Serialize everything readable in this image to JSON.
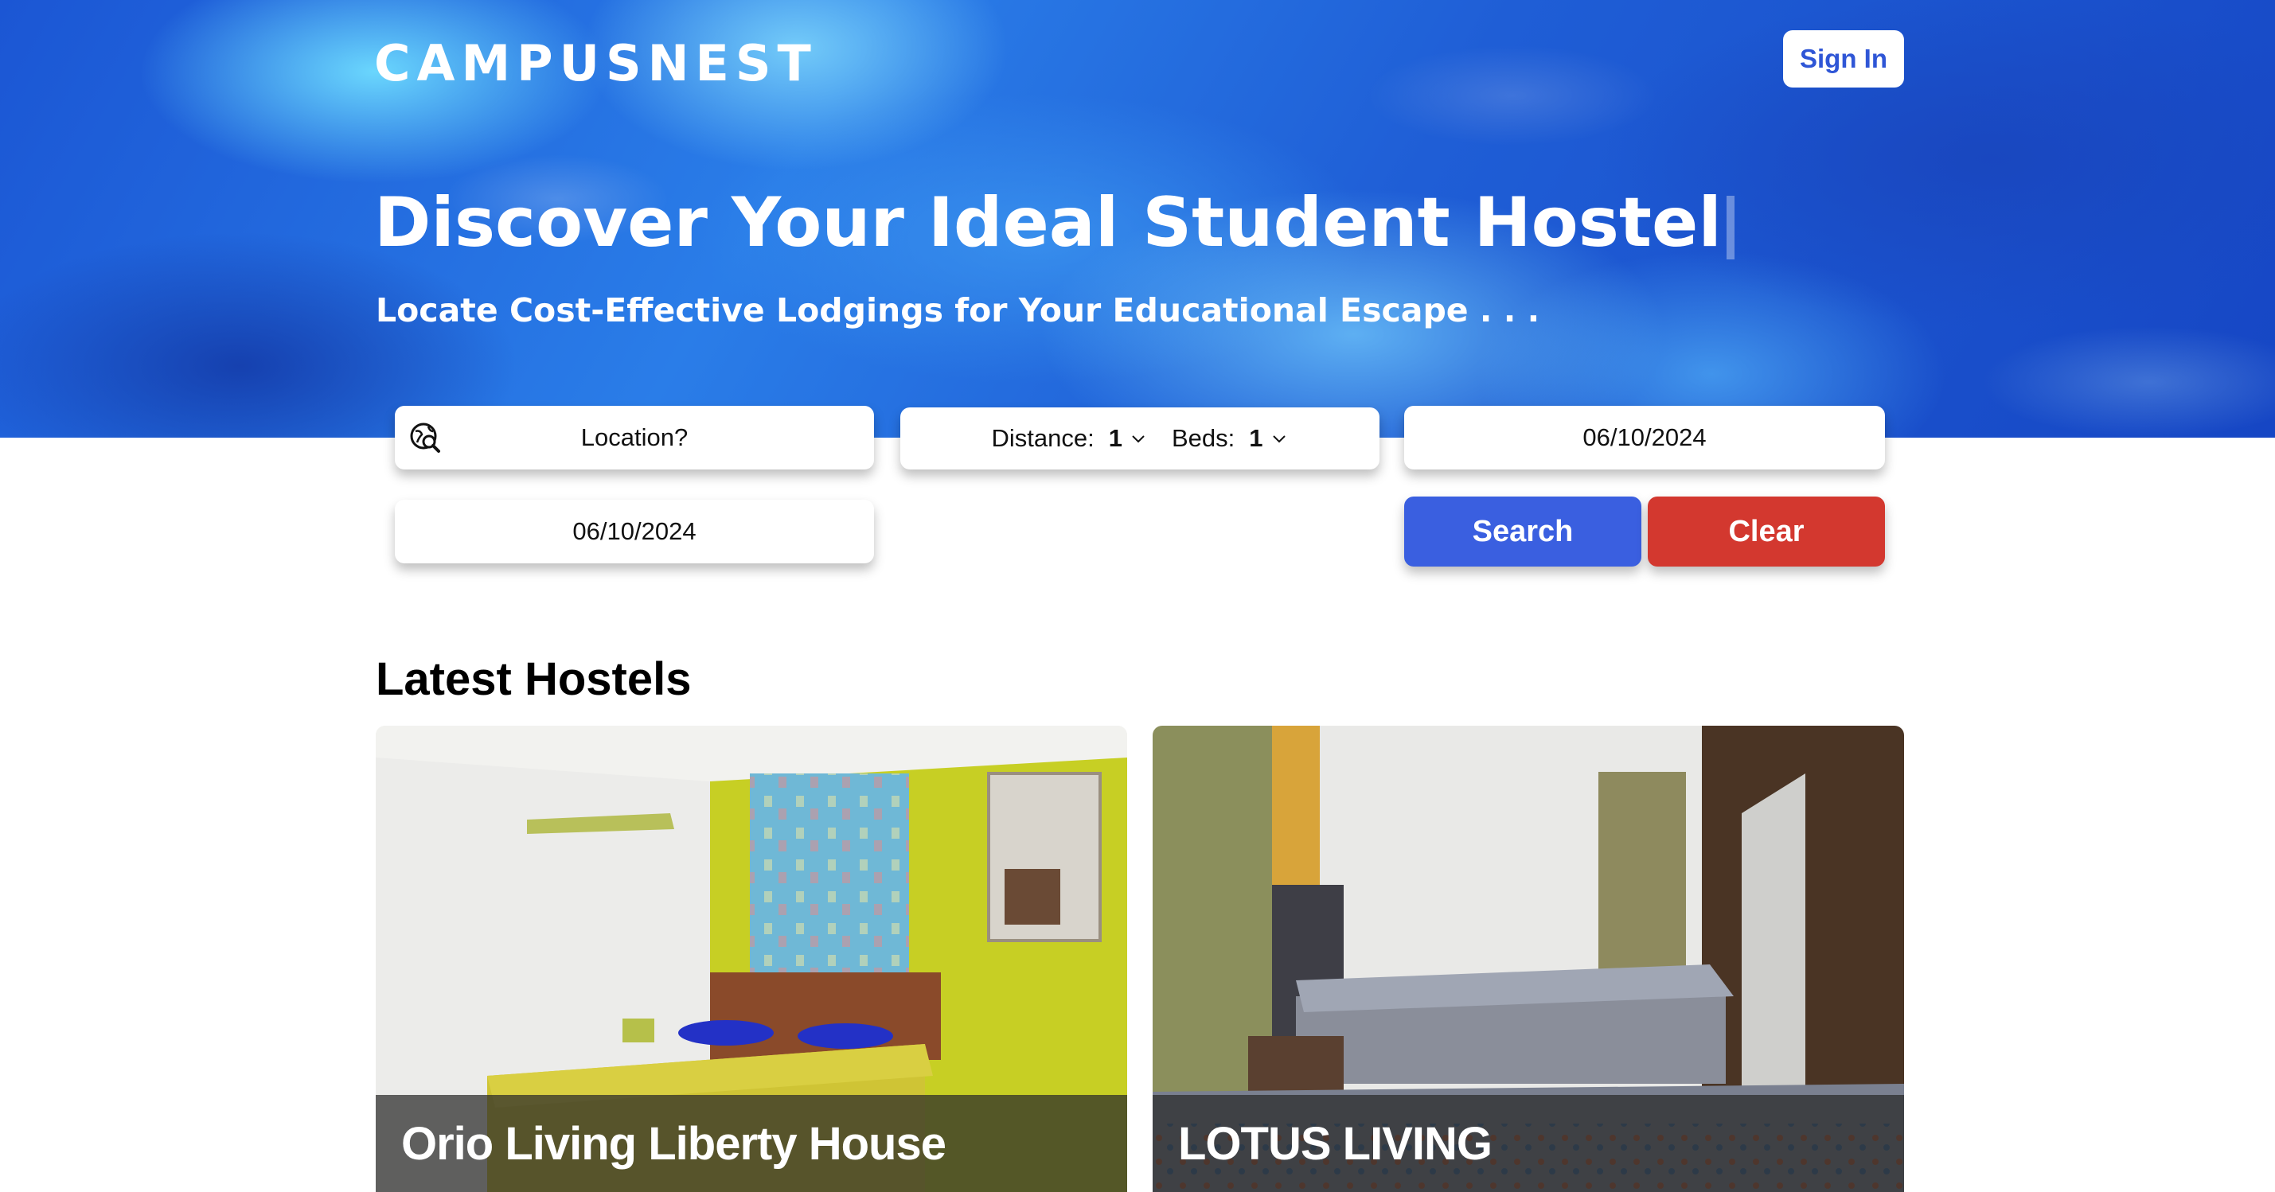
{
  "header": {
    "logo": "CAMPUSNEST",
    "sign_in_label": "Sign In"
  },
  "hero": {
    "headline": "Discover Your Ideal Student Hostel",
    "subline": "Locate Cost-Effective Lodgings for Your Educational Escape . . ."
  },
  "search": {
    "location_placeholder": "Location?",
    "location_icon": "location-search-icon",
    "distance_label": "Distance:",
    "distance_value": "1",
    "beds_label": "Beds:",
    "beds_value": "1",
    "check_in_date": "06/10/2024",
    "check_out_date": "06/10/2024",
    "search_label": "Search",
    "clear_label": "Clear"
  },
  "latest": {
    "title": "Latest Hostels",
    "hostels": [
      {
        "name": "Orio Living Liberty House"
      },
      {
        "name": "LOTUS LIVING"
      }
    ]
  },
  "colors": {
    "search_button": "#3a5fe0",
    "clear_button": "#d3382f",
    "sign_in_text": "#2f56d6"
  }
}
